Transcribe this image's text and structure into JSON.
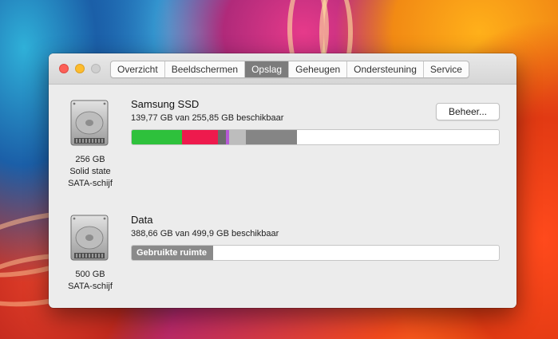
{
  "tabs": [
    {
      "label": "Overzicht",
      "active": false
    },
    {
      "label": "Beeldschermen",
      "active": false
    },
    {
      "label": "Opslag",
      "active": true
    },
    {
      "label": "Geheugen",
      "active": false
    },
    {
      "label": "Ondersteuning",
      "active": false
    },
    {
      "label": "Service",
      "active": false
    }
  ],
  "disks": [
    {
      "name": "Samsung SSD",
      "availability": "139,77 GB van 255,85 GB beschikbaar",
      "caption": [
        "256 GB",
        "Solid state",
        "SATA-schijf"
      ],
      "manage_button": "Beheer...",
      "usage_segments": [
        {
          "color": "#2ec13c",
          "fraction": 0.138
        },
        {
          "color": "#ee1a4d",
          "fraction": 0.097
        },
        {
          "color": "#6c6c6c",
          "fraction": 0.022
        },
        {
          "color": "#b659d6",
          "fraction": 0.009
        },
        {
          "color": "#bdbdbd",
          "fraction": 0.046
        },
        {
          "color": "#858585",
          "fraction": 0.139
        }
      ]
    },
    {
      "name": "Data",
      "availability": "388,66 GB van 499,9 GB beschikbaar",
      "caption": [
        "500 GB",
        "SATA-schijf"
      ],
      "used_label": "Gebruikte ruimte",
      "used_fraction": 0.222
    }
  ]
}
